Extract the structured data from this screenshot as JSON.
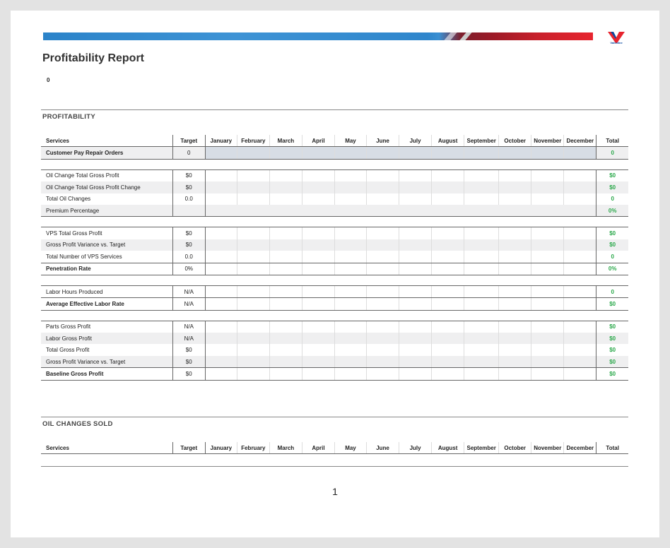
{
  "report": {
    "title": "Profitability Report",
    "subtitle_value": "0",
    "page_number": "1",
    "logo_text": "Valvoline"
  },
  "sections": {
    "profitability": "PROFITABILITY",
    "oil_changes": "OIL CHANGES SOLD"
  },
  "columns": [
    "Services",
    "Target",
    "January",
    "February",
    "March",
    "April",
    "May",
    "June",
    "July",
    "August",
    "September",
    "October",
    "November",
    "December",
    "Total"
  ],
  "rows": {
    "cpro": {
      "label": "Customer Pay Repair Orders",
      "target": "0",
      "total": "0"
    },
    "oc_gp": {
      "label": "Oil Change Total Gross Profit",
      "target": "$0",
      "total": "$0"
    },
    "oc_gp_change": {
      "label": "Oil Change Total Gross Profit Change",
      "target": "$0",
      "total": "$0"
    },
    "total_oc": {
      "label": "Total Oil Changes",
      "target": "0.0",
      "total": "0"
    },
    "premium": {
      "label": "Premium Percentage",
      "target": "",
      "total": "0%"
    },
    "vps_gp": {
      "label": "VPS Total Gross Profit",
      "target": "$0",
      "total": "$0"
    },
    "gp_var1": {
      "label": "Gross Profit Variance vs. Target",
      "target": "$0",
      "total": "$0"
    },
    "vps_num": {
      "label": "Total Number of VPS Services",
      "target": "0.0",
      "total": "0"
    },
    "penetration": {
      "label": "Penetration Rate",
      "target": "0%",
      "total": "0%"
    },
    "labor_hours": {
      "label": "Labor Hours Produced",
      "target": "N/A",
      "total": "0"
    },
    "labor_rate": {
      "label": "Average Effective Labor Rate",
      "target": "N/A",
      "total": "$0"
    },
    "parts_gp": {
      "label": "Parts Gross Profit",
      "target": "N/A",
      "total": "$0"
    },
    "labor_gp": {
      "label": "Labor Gross Profit",
      "target": "N/A",
      "total": "$0"
    },
    "total_gp": {
      "label": "Total Gross Profit",
      "target": "$0",
      "total": "$0"
    },
    "gp_var2": {
      "label": "Gross Profit Variance vs. Target",
      "target": "$0",
      "total": "$0"
    },
    "baseline": {
      "label": "Baseline Gross Profit",
      "target": "$0",
      "total": "$0"
    }
  },
  "colors": {
    "banner_blue": "#2b83c9",
    "banner_red": "#e7242e",
    "total_green": "#2aa84a",
    "gray_cell": "#d7dde5"
  }
}
